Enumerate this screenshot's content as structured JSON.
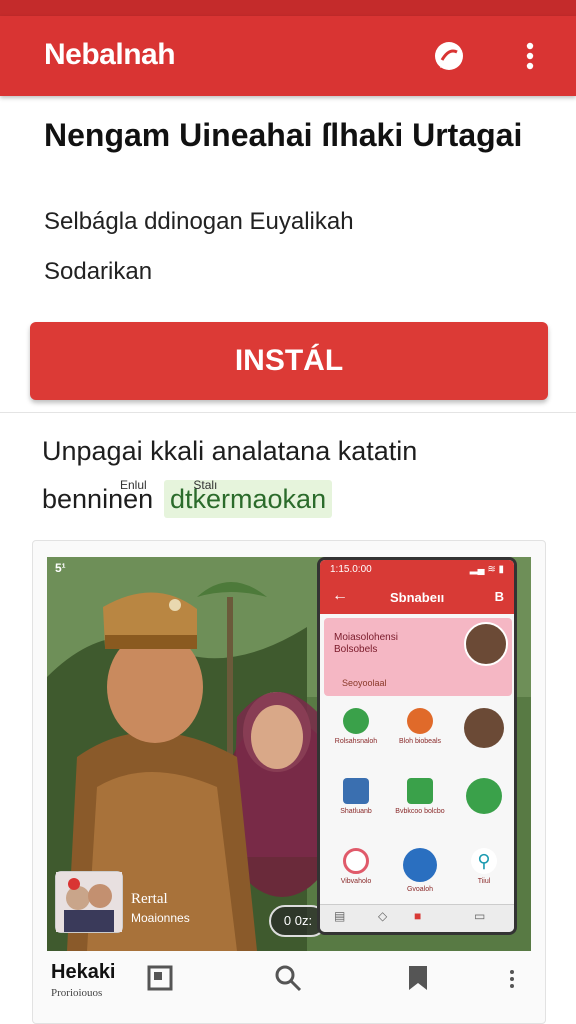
{
  "app_bar": {
    "title": "Nebalnah",
    "chat_icon": "chat-bubble-icon",
    "menu_icon": "more-vert-icon",
    "color": "#d93433"
  },
  "listing": {
    "headline": "Nengam Uineahai ſlhaki Urtagai",
    "subtitle": "Selbágla ddinogan Euyalikah",
    "subtitle2": "Sodarikan",
    "install_label": "INSTÁL",
    "install_color": "#dc3a36"
  },
  "description": {
    "line1": "Unpagai kkali analatana katatin",
    "line2_prefix": "benninen",
    "highlight": "dtkermaokan"
  },
  "screenshot": {
    "corner_tag": "5¹",
    "mini_name": "Rertal",
    "mini_sub": "Moaionnes",
    "pill_label": "0 0z:",
    "phone": {
      "status_time": "1:15.0:00",
      "status_right": "▂▄ ≋ ▮",
      "title": "Sbnabeıı",
      "back_icon": "arrow-back-icon",
      "menu_label": "B",
      "banner_text": "Moiasolohensi Bolsobels",
      "banner_sub": "Seoyoolaal",
      "grid": [
        {
          "label": "Rolsahsnaloh",
          "color": "#3aa14a",
          "icon": "search-icon"
        },
        {
          "label": "Bloh biobeals",
          "color": "#e06a2a",
          "icon": "apps-icon"
        },
        {
          "label": "",
          "color": "#6b4a36",
          "icon": "avatar"
        },
        {
          "label": "Shatluanb",
          "color": "#3a6fb0",
          "icon": "book-icon"
        },
        {
          "label": "Bvbkcoo bolcbo",
          "color": "#3aa14a",
          "icon": "chat-icon"
        },
        {
          "label": "",
          "color": "#3aa14a",
          "icon": "phone-icon"
        },
        {
          "label": "Vibvaholo",
          "color": "#e05a6a",
          "icon": "music-icon"
        },
        {
          "label": "Gvoaloh",
          "color": "#2a6fc0",
          "icon": "compass-icon"
        },
        {
          "label": "Tiiul",
          "color": "#1a9ab0",
          "icon": "tool-icon"
        }
      ],
      "nav": [
        "▤",
        "◇",
        "■",
        "▭"
      ]
    }
  },
  "bottom_bar": {
    "title": "Hekaki",
    "subtitle": "Prorioiouos",
    "bottom_text": "Enlul              Stalı"
  }
}
